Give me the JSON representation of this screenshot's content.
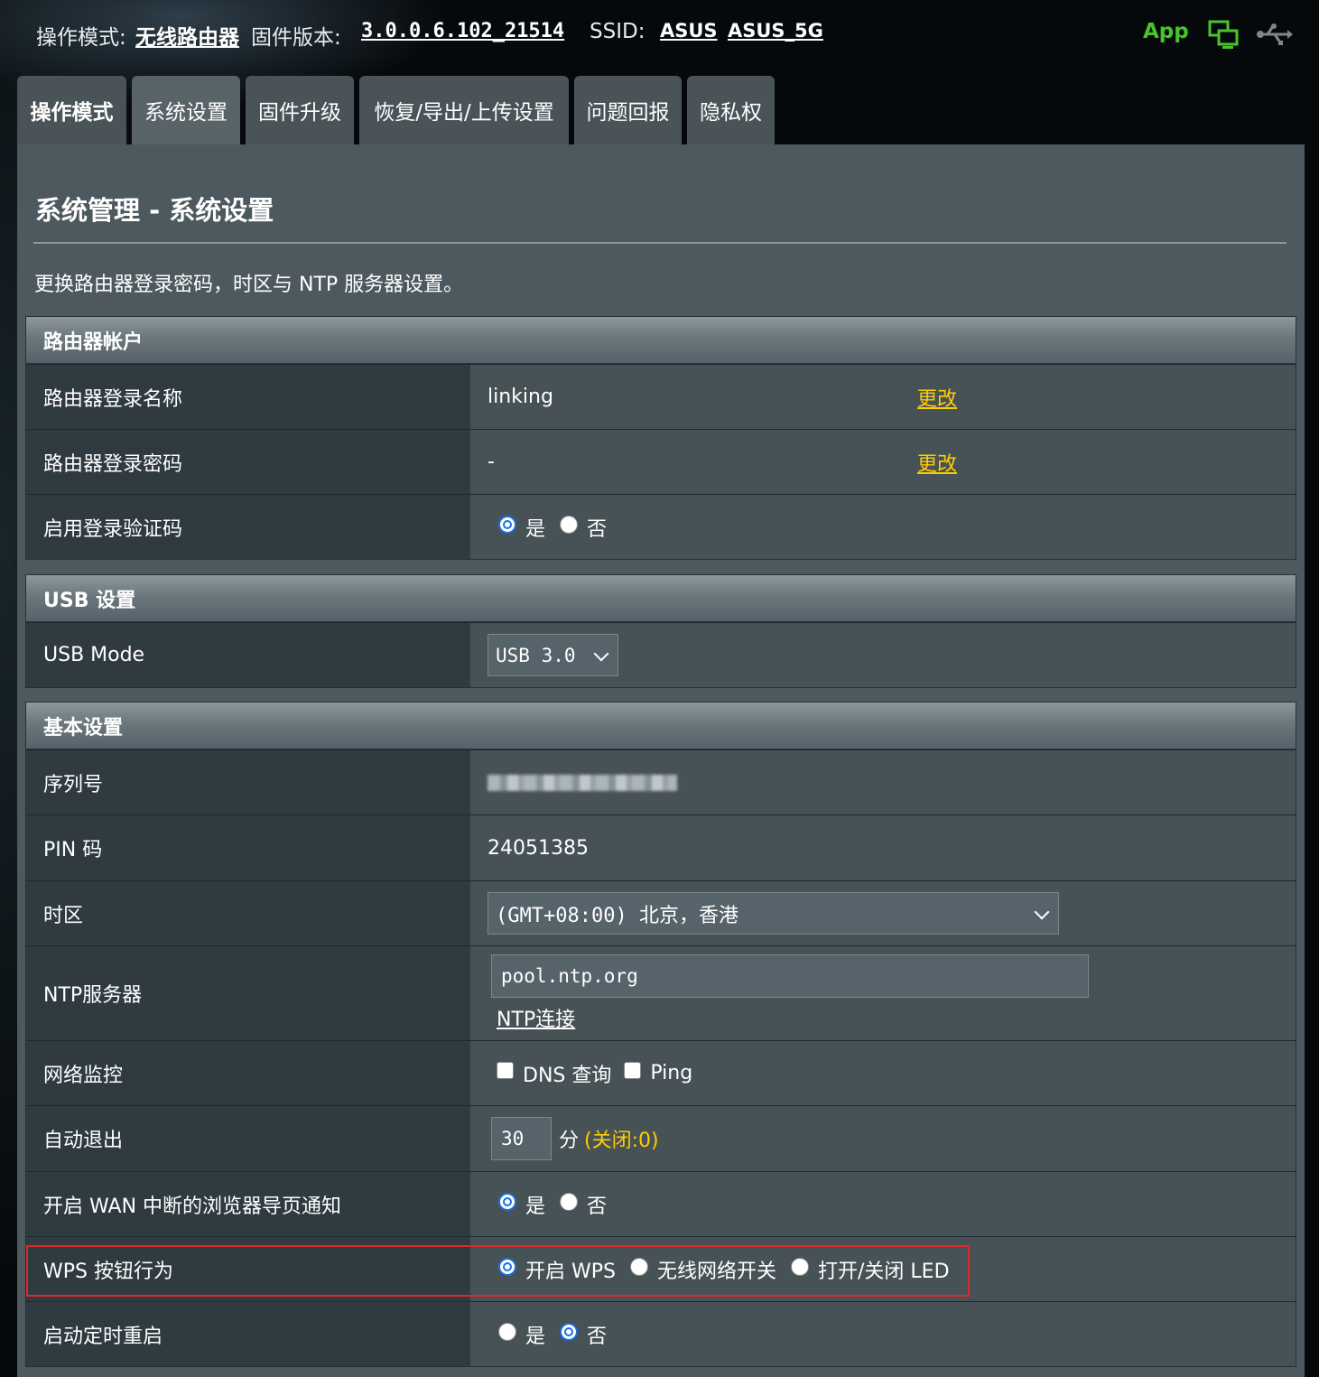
{
  "topbar": {
    "op_mode_label": "操作模式:",
    "op_mode_value": "无线路由器",
    "firmware_label": "固件版本:",
    "firmware_value": "3.0.0.6.102_21514",
    "ssid_label": "SSID:",
    "ssid_1": "ASUS",
    "ssid_2": "ASUS_5G",
    "app_label": "App",
    "icons": [
      "network-status-icon",
      "usb-status-icon"
    ],
    "app_color": "#48c52a"
  },
  "tabs": [
    {
      "label": "操作模式",
      "active": false
    },
    {
      "label": "系统设置",
      "active": true
    },
    {
      "label": "固件升级",
      "active": false
    },
    {
      "label": "恢复/导出/上传设置",
      "active": false
    },
    {
      "label": "问题回报",
      "active": false
    },
    {
      "label": "隐私权",
      "active": false
    }
  ],
  "page": {
    "title": "系统管理 - 系统设置",
    "description": "更换路由器登录密码，时区与 NTP 服务器设置。"
  },
  "router_account": {
    "header": "路由器帐户",
    "login_name_label": "路由器登录名称",
    "login_name_value": "linking",
    "login_password_label": "路由器登录密码",
    "login_password_value": "-",
    "change_label": "更改",
    "captcha_label": "启用登录验证码",
    "captcha_yes": "是",
    "captcha_no": "否",
    "captcha_selected": "是"
  },
  "usb": {
    "header": "USB 设置",
    "mode_label": "USB Mode",
    "mode_value": "USB 3.0"
  },
  "basic": {
    "header": "基本设置",
    "serial_label": "序列号",
    "pin_label": "PIN 码",
    "pin_value": "24051385",
    "timezone_label": "时区",
    "timezone_value": "(GMT+08:00) 北京，香港",
    "ntp_label": "NTP服务器",
    "ntp_value": "pool.ntp.org",
    "ntp_link": "NTP连接",
    "netmon_label": "网络监控",
    "netmon_dns": "DNS 查询",
    "netmon_ping": "Ping",
    "autologout_label": "自动退出",
    "autologout_value": "30",
    "autologout_unit": "分",
    "autologout_hint": "(关闭:0)",
    "wan_notify_label": "开启 WAN 中断的浏览器导页通知",
    "wan_notify_yes": "是",
    "wan_notify_no": "否",
    "wan_notify_selected": "是",
    "wps_label": "WPS 按钮行为",
    "wps_opt1": "开启 WPS",
    "wps_opt2": "无线网络开关",
    "wps_opt3": "打开/关闭 LED",
    "wps_selected": "开启 WPS",
    "reboot_label": "启动定时重启",
    "reboot_yes": "是",
    "reboot_no": "否",
    "reboot_selected": "否"
  },
  "colors": {
    "link_yellow": "#ffcc00",
    "highlight_red": "#e0282c",
    "radio_blue": "#1a6fe0"
  }
}
